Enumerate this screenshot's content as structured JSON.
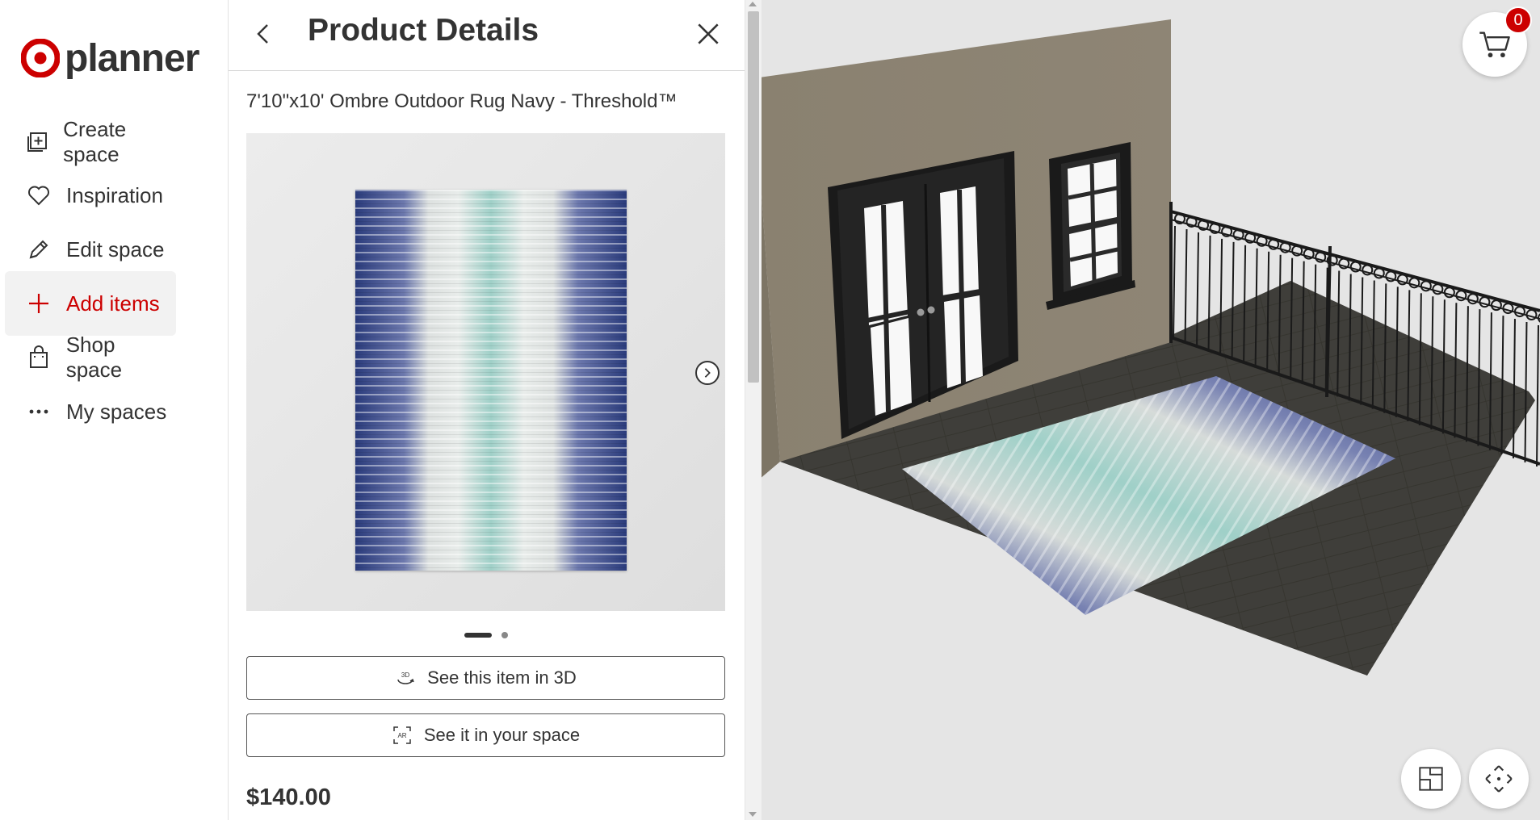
{
  "app": {
    "brand": "planner",
    "accent_color": "#cc0000"
  },
  "nav": {
    "items": [
      {
        "label": "Create space",
        "icon": "create-space-icon"
      },
      {
        "label": "Inspiration",
        "icon": "heart-icon"
      },
      {
        "label": "Edit space",
        "icon": "pencil-icon"
      },
      {
        "label": "Add items",
        "icon": "plus-icon",
        "active": true
      },
      {
        "label": "Shop space",
        "icon": "shopping-bag-icon"
      },
      {
        "label": "My spaces",
        "icon": "ellipsis-icon"
      }
    ]
  },
  "panel": {
    "title": "Product Details",
    "product_name": "7'10\"x10' Ombre Outdoor Rug Navy - Threshold™",
    "carousel": {
      "current": 1,
      "total": 2
    },
    "buttons": {
      "view_3d": "See this item in 3D",
      "view_ar": "See it in your space"
    },
    "icon_text": {
      "three_d": "3D",
      "ar": "AR"
    },
    "price": "$140.00"
  },
  "viewport": {
    "cart_count": "0",
    "controls": [
      "floorplan-icon",
      "move-arrows-icon"
    ]
  }
}
